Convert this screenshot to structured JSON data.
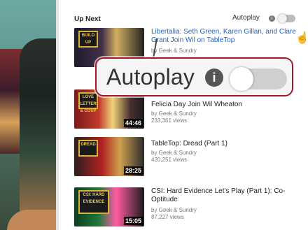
{
  "sidebar": {
    "up_next_label": "Up Next",
    "autoplay_label": "Autoplay",
    "info_symbol": "i"
  },
  "callout": {
    "autoplay_label": "Autoplay",
    "info_symbol": "i"
  },
  "videos": [
    {
      "title": "Libertalia: Seth Green, Karen Gillan, and Clare Grant Join Wil on TableTop",
      "channel": "by Geek & Sundry",
      "views": "",
      "duration": "",
      "thumb_badge": "BUILD UP"
    },
    {
      "title": "Felicia Day Join Wil Wheaton",
      "channel": "by Geek & Sundry",
      "views": "233,361 views",
      "duration": "44:46",
      "thumb_badge": "LOVE LETTER & COUP"
    },
    {
      "title": "TableTop: Dread (Part 1)",
      "channel": "by Geek & Sundry",
      "views": "420,251 views",
      "duration": "28:25",
      "thumb_badge": "DREAD"
    },
    {
      "title": "CSI: Hard Evidence Let's Play (Part 1): Co-Optitude",
      "channel": "by Geek & Sundry",
      "views": "87,227 views",
      "duration": "15:05",
      "thumb_badge": "CSI: HARD EVIDENCE"
    }
  ],
  "colors": {
    "link_blue": "#2563c7",
    "callout_border": "#9f1b2c",
    "toggle_track": "#cfcfcf"
  },
  "icons": {
    "info": "info-icon",
    "toggle": "toggle-switch",
    "cursor": "hand-pointer-icon"
  }
}
